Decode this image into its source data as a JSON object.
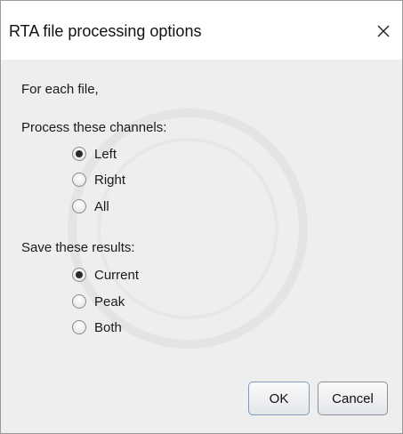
{
  "window": {
    "title": "RTA file processing options",
    "close_icon": "close-icon"
  },
  "dialog": {
    "intro": "For each file,",
    "channels": {
      "heading": "Process these channels:",
      "options": [
        {
          "label": "Left",
          "checked": true
        },
        {
          "label": "Right",
          "checked": false
        },
        {
          "label": "All",
          "checked": false
        }
      ]
    },
    "results": {
      "heading": "Save these results:",
      "options": [
        {
          "label": "Current",
          "checked": true
        },
        {
          "label": "Peak",
          "checked": false
        },
        {
          "label": "Both",
          "checked": false
        }
      ]
    },
    "buttons": {
      "ok": "OK",
      "cancel": "Cancel"
    }
  },
  "colors": {
    "titlebar": "#ffffff",
    "content_bg": "#eeeeee",
    "radio_dot": "#2b2b2b"
  }
}
